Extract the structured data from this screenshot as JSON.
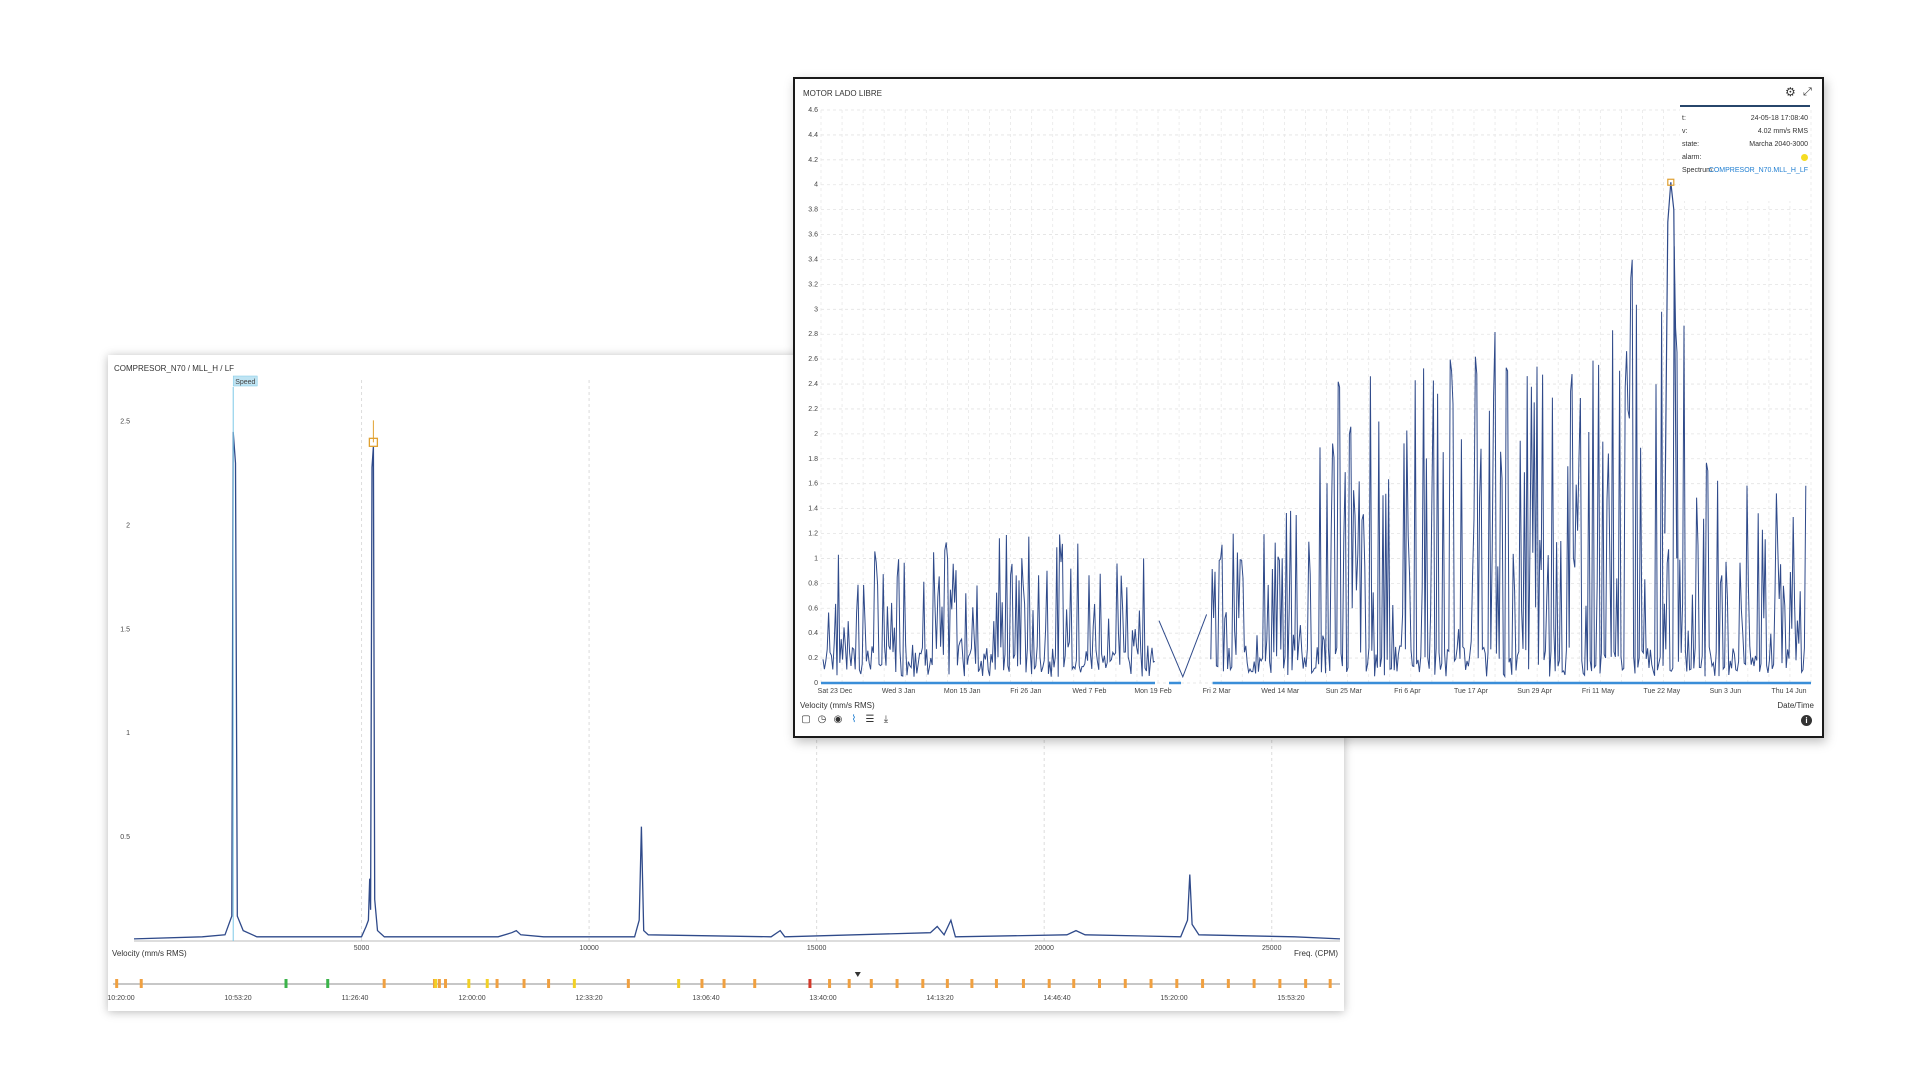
{
  "spectrum": {
    "title": "COMPRESOR_N70 / MLL_H / LF",
    "speed_badge": "Speed",
    "y_axis_label": "Velocity (mm/s RMS)",
    "x_axis_label": "Freq. (CPM)",
    "colors": {
      "line": "#2f4a8a",
      "speed_marker": "#7cc8e6",
      "cursor": "#e0a030",
      "grid": "#dcdcdc"
    },
    "timeline": {
      "times": [
        "10:20:00",
        "10:53:20",
        "11:26:40",
        "12:00:00",
        "12:33:20",
        "13:06:40",
        "13:40:00",
        "14:13:20",
        "14:46:40",
        "15:20:00",
        "15:53:20"
      ],
      "markers": [
        {
          "t": 0.003,
          "c": "orange"
        },
        {
          "t": 0.023,
          "c": "orange"
        },
        {
          "t": 0.141,
          "c": "green"
        },
        {
          "t": 0.175,
          "c": "green"
        },
        {
          "t": 0.221,
          "c": "orange"
        },
        {
          "t": 0.262,
          "c": "orange"
        },
        {
          "t": 0.271,
          "c": "orange"
        },
        {
          "t": 0.266,
          "c": "orange"
        },
        {
          "t": 0.263,
          "c": "yellow"
        },
        {
          "t": 0.313,
          "c": "orange"
        },
        {
          "t": 0.29,
          "c": "yellow"
        },
        {
          "t": 0.335,
          "c": "orange"
        },
        {
          "t": 0.355,
          "c": "orange"
        },
        {
          "t": 0.305,
          "c": "yellow"
        },
        {
          "t": 0.376,
          "c": "yellow"
        },
        {
          "t": 0.42,
          "c": "orange"
        },
        {
          "t": 0.461,
          "c": "yellow"
        },
        {
          "t": 0.48,
          "c": "orange"
        },
        {
          "t": 0.498,
          "c": "orange"
        },
        {
          "t": 0.523,
          "c": "orange"
        },
        {
          "t": 0.568,
          "c": "red"
        },
        {
          "t": 0.584,
          "c": "orange"
        },
        {
          "t": 0.6,
          "c": "orange"
        },
        {
          "t": 0.618,
          "c": "orange"
        },
        {
          "t": 0.639,
          "c": "orange"
        },
        {
          "t": 0.66,
          "c": "orange"
        },
        {
          "t": 0.68,
          "c": "orange"
        },
        {
          "t": 0.7,
          "c": "orange"
        },
        {
          "t": 0.72,
          "c": "orange"
        },
        {
          "t": 0.742,
          "c": "orange"
        },
        {
          "t": 0.763,
          "c": "orange"
        },
        {
          "t": 0.783,
          "c": "orange"
        },
        {
          "t": 0.804,
          "c": "orange"
        },
        {
          "t": 0.825,
          "c": "orange"
        },
        {
          "t": 0.846,
          "c": "orange"
        },
        {
          "t": 0.867,
          "c": "orange"
        },
        {
          "t": 0.888,
          "c": "orange"
        },
        {
          "t": 0.909,
          "c": "orange"
        },
        {
          "t": 0.93,
          "c": "orange"
        },
        {
          "t": 0.951,
          "c": "orange"
        },
        {
          "t": 0.972,
          "c": "orange"
        },
        {
          "t": 0.992,
          "c": "orange"
        }
      ],
      "pointer": 0.607
    }
  },
  "trend": {
    "title": "MOTOR LADO LIBRE",
    "y_axis_label": "Velocity (mm/s RMS)",
    "x_axis_label": "Date/Time",
    "gear_icon": "gear-icon",
    "expand_icon": "expand-icon",
    "info_icon": "info-icon",
    "info_glyph": "i",
    "toolbar_icons": [
      "zoom-icon",
      "history-icon",
      "eye-icon",
      "chart-icon",
      "list-icon",
      "download-icon"
    ],
    "tooltip": {
      "rows": [
        {
          "key": "t:",
          "value": "24-05-18 17:08:40"
        },
        {
          "key": "v:",
          "value": "4.02 mm/s RMS"
        },
        {
          "key": "state:",
          "value": "Marcha 2040-3000"
        },
        {
          "key": "alarm:",
          "value": ""
        },
        {
          "key": "Spectrum:",
          "value": "COMPRESOR_N70.MLL_H_LF"
        }
      ]
    },
    "colors": {
      "line": "#2f4a8a",
      "baseline": "#3a8ed8",
      "cursor": "#e0a030",
      "alarm": "#f5dc22"
    }
  },
  "chart_data": [
    {
      "type": "line",
      "title": "COMPRESOR_N70 / MLL_H / LF",
      "xlabel": "Freq. (CPM)",
      "ylabel": "Velocity (mm/s RMS)",
      "xlim": [
        0,
        26500
      ],
      "ylim": [
        0,
        2.7
      ],
      "xticks": [
        5000,
        10000,
        15000,
        20000,
        25000
      ],
      "yticks": [
        0.5,
        1,
        1.5,
        2,
        2.5
      ],
      "grid": true,
      "series": [
        {
          "points": [
            [
              0,
              0.01
            ],
            [
              1500,
              0.02
            ],
            [
              2000,
              0.03
            ],
            [
              2150,
              0.12
            ],
            [
              2180,
              2.45
            ],
            [
              2230,
              2.3
            ],
            [
              2270,
              0.12
            ],
            [
              2400,
              0.05
            ],
            [
              2700,
              0.02
            ],
            [
              4500,
              0.02
            ],
            [
              5000,
              0.02
            ],
            [
              5100,
              0.07
            ],
            [
              5150,
              0.1
            ],
            [
              5180,
              0.3
            ],
            [
              5200,
              0.15
            ],
            [
              5230,
              2.28
            ],
            [
              5260,
              2.38
            ],
            [
              5290,
              0.2
            ],
            [
              5350,
              0.05
            ],
            [
              5500,
              0.02
            ],
            [
              8000,
              0.02
            ],
            [
              8300,
              0.04
            ],
            [
              8400,
              0.05
            ],
            [
              8500,
              0.03
            ],
            [
              9000,
              0.02
            ],
            [
              11000,
              0.02
            ],
            [
              11100,
              0.1
            ],
            [
              11150,
              0.55
            ],
            [
              11200,
              0.05
            ],
            [
              11300,
              0.03
            ],
            [
              14000,
              0.02
            ],
            [
              14200,
              0.05
            ],
            [
              14300,
              0.02
            ],
            [
              17500,
              0.04
            ],
            [
              17650,
              0.07
            ],
            [
              17800,
              0.03
            ],
            [
              17950,
              0.1
            ],
            [
              18050,
              0.02
            ],
            [
              20500,
              0.03
            ],
            [
              20700,
              0.05
            ],
            [
              20900,
              0.03
            ],
            [
              23000,
              0.02
            ],
            [
              23150,
              0.1
            ],
            [
              23200,
              0.32
            ],
            [
              23250,
              0.08
            ],
            [
              23400,
              0.03
            ],
            [
              25500,
              0.02
            ],
            [
              26500,
              0.01
            ]
          ]
        }
      ],
      "annotations": [
        {
          "label": "Speed",
          "x": 2180
        },
        {
          "label": "cursor",
          "x": 5260,
          "y": 2.4
        }
      ]
    },
    {
      "type": "line",
      "title": "MOTOR LADO LIBRE",
      "xlabel": "Date/Time",
      "ylabel": "Velocity (mm/s RMS)",
      "ylim": [
        0,
        4.6
      ],
      "yticks": [
        0,
        0.2,
        0.4,
        0.6,
        0.8,
        1,
        1.2,
        1.4,
        1.6,
        1.8,
        2,
        2.2,
        2.4,
        2.6,
        2.8,
        3,
        3.2,
        3.4,
        3.6,
        3.8,
        4,
        4.2,
        4.4,
        4.6
      ],
      "xticks": [
        "Sat 23 Dec",
        "Wed 3 Jan",
        "Mon 15 Jan",
        "Fri 26 Jan",
        "Wed 7 Feb",
        "Mon 19 Feb",
        "Fri 2 Mar",
        "Wed 14 Mar",
        "Sun 25 Mar",
        "Fri 6 Apr",
        "Tue 17 Apr",
        "Sun 29 Apr",
        "Fri 11 May",
        "Tue 22 May",
        "Sun 3 Jun",
        "Thu 14 Jun"
      ],
      "grid": true,
      "envelope": [
        {
          "x": "Sat 23 Dec",
          "max": 0.95
        },
        {
          "x": "Wed 3 Jan",
          "max": 1.0
        },
        {
          "x": "Mon 15 Jan",
          "max": 1.05
        },
        {
          "x": "Fri 26 Jan",
          "max": 1.15
        },
        {
          "x": "Wed 7 Feb",
          "max": 1.05
        },
        {
          "x": "Mon 19 Feb",
          "max": 1.0
        },
        {
          "x": "Fri 2 Mar",
          "max": 1.1
        },
        {
          "x": "Wed 14 Mar",
          "max": 1.15
        },
        {
          "x": "Sun 25 Mar",
          "max": 2.5
        },
        {
          "x": "Fri 6 Apr",
          "max": 2.5
        },
        {
          "x": "Tue 17 Apr",
          "max": 2.7
        },
        {
          "x": "Sun 29 Apr",
          "max": 3.0
        },
        {
          "x": "Fri 11 May",
          "max": 2.6
        },
        {
          "x": "Tue 22 May",
          "max": 4.02
        },
        {
          "x": "Sun 3 Jun",
          "max": 1.5
        },
        {
          "x": "Thu 14 Jun",
          "max": 1.5
        }
      ],
      "gap": [
        "Mon 19 Feb",
        "Fri 2 Mar"
      ],
      "highlight": {
        "x": "Tue 22 May",
        "y": 4.02
      }
    }
  ]
}
